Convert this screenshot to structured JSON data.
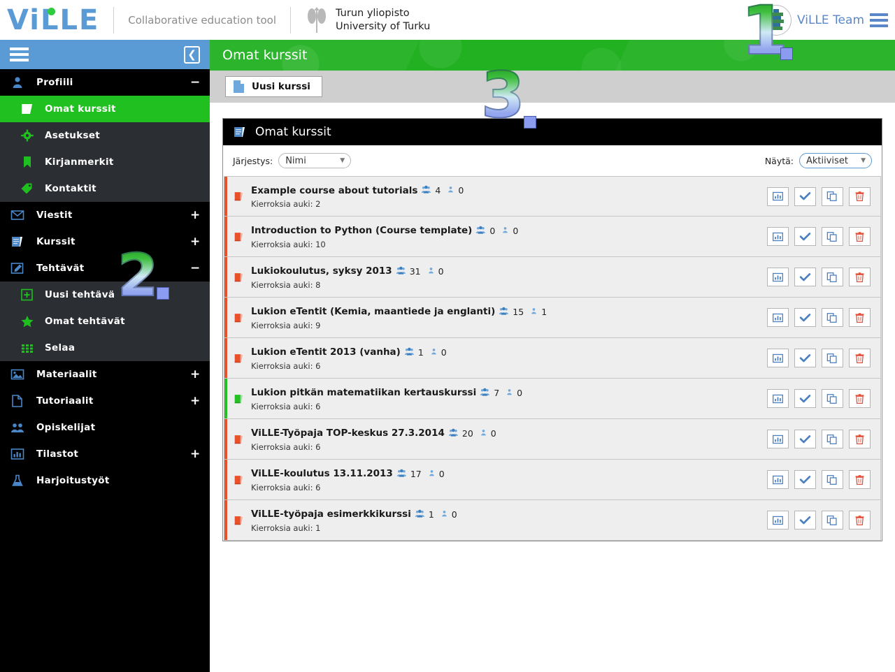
{
  "topbar": {
    "logo_text": "ViLLE",
    "tagline": "Collaborative education tool",
    "university_fi": "Turun yliopisto",
    "university_en": "University of Turku",
    "user_name": "ViLLE Team",
    "menu_icon": "hamburger-icon",
    "avatar_icon": "ville-avatar-icon"
  },
  "sidebar": {
    "menu_icon": "hamburger-icon",
    "collapse_icon": "chevron-left-icon",
    "groups": [
      {
        "label": "Profiili",
        "icon": "user-icon",
        "toggle": "−",
        "expanded": true,
        "items": [
          {
            "label": "Omat kurssit",
            "icon": "book-icon",
            "active": true
          },
          {
            "label": "Asetukset",
            "icon": "gear-icon",
            "active": false
          },
          {
            "label": "Kirjanmerkit",
            "icon": "bookmark-icon",
            "active": false
          },
          {
            "label": "Kontaktit",
            "icon": "tag-icon",
            "active": false
          }
        ]
      },
      {
        "label": "Viestit",
        "icon": "envelope-icon",
        "toggle": "+",
        "expanded": false,
        "items": []
      },
      {
        "label": "Kurssit",
        "icon": "book-icon",
        "toggle": "+",
        "expanded": false,
        "items": []
      },
      {
        "label": "Tehtävät",
        "icon": "pencil-square-icon",
        "toggle": "−",
        "expanded": true,
        "items": [
          {
            "label": "Uusi tehtävä",
            "icon": "plus-square-icon",
            "active": false
          },
          {
            "label": "Omat tehtävät",
            "icon": "star-icon",
            "active": false
          },
          {
            "label": "Selaa",
            "icon": "grid-icon",
            "active": false
          }
        ]
      },
      {
        "label": "Materiaalit",
        "icon": "image-icon",
        "toggle": "+",
        "expanded": false,
        "items": []
      },
      {
        "label": "Tutoriaalit",
        "icon": "document-icon",
        "toggle": "+",
        "expanded": false,
        "items": []
      },
      {
        "label": "Opiskelijat",
        "icon": "people-icon",
        "toggle": "",
        "expanded": false,
        "items": []
      },
      {
        "label": "Tilastot",
        "icon": "chart-icon",
        "toggle": "+",
        "expanded": false,
        "items": []
      },
      {
        "label": "Harjoitustyöt",
        "icon": "flask-icon",
        "toggle": "",
        "expanded": false,
        "items": []
      }
    ]
  },
  "page": {
    "header_title": "Omat kurssit",
    "new_course_button": "Uusi kurssi",
    "new_course_icon": "document-icon",
    "panel_title": "Omat kurssit",
    "panel_icon": "book-icon"
  },
  "filters": {
    "sort_label": "Järjestys:",
    "sort_value": "Nimi",
    "show_label": "Näytä:",
    "show_value": "Aktiiviset",
    "caret_icon": "chevron-down-icon"
  },
  "row_actions": [
    {
      "name": "statistics-button",
      "icon": "bar-chart-icon"
    },
    {
      "name": "approve-button",
      "icon": "check-icon"
    },
    {
      "name": "copy-button",
      "icon": "copy-icon"
    },
    {
      "name": "delete-button",
      "icon": "trash-icon"
    }
  ],
  "labels": {
    "rounds_prefix": "Kierroksia auki:"
  },
  "courses": [
    {
      "title": "Example course about tutorials",
      "students": "4",
      "teachers": "0",
      "rounds": "Kierroksia auki: 2",
      "color": "#e8512a"
    },
    {
      "title": "Introduction to Python (Course template)",
      "students": "0",
      "teachers": "0",
      "rounds": "Kierroksia auki: 10",
      "color": "#e8512a"
    },
    {
      "title": "Lukiokoulutus, syksy 2013",
      "students": "31",
      "teachers": "0",
      "rounds": "Kierroksia auki: 8",
      "color": "#e8512a"
    },
    {
      "title": "Lukion eTentit (Kemia, maantiede ja englanti)",
      "students": "15",
      "teachers": "1",
      "rounds": "Kierroksia auki: 9",
      "color": "#e8512a"
    },
    {
      "title": "Lukion eTentit 2013 (vanha)",
      "students": "1",
      "teachers": "0",
      "rounds": "Kierroksia auki: 6",
      "color": "#e8512a"
    },
    {
      "title": "Lukion pitkän matematiikan kertauskurssi",
      "students": "7",
      "teachers": "0",
      "rounds": "Kierroksia auki: 6",
      "color": "#24c024"
    },
    {
      "title": "ViLLE-Työpaja TOP-keskus 27.3.2014",
      "students": "20",
      "teachers": "0",
      "rounds": "Kierroksia auki: 6",
      "color": "#e8512a"
    },
    {
      "title": "ViLLE-koulutus 13.11.2013",
      "students": "17",
      "teachers": "0",
      "rounds": "Kierroksia auki: 6",
      "color": "#e8512a"
    },
    {
      "title": "ViLLE-työpaja esimerkkikurssi",
      "students": "1",
      "teachers": "0",
      "rounds": "Kierroksia auki: 1",
      "color": "#e8512a"
    }
  ],
  "annotations": [
    {
      "number": "1",
      "target": "user-menu"
    },
    {
      "number": "2",
      "target": "new-task"
    },
    {
      "number": "3",
      "target": "course-panel"
    }
  ],
  "colors": {
    "accent_green": "#21b121",
    "sidebar_blue": "#5b9bd5",
    "active_green": "#21c021",
    "row_orange": "#e8512a",
    "link_blue": "#5b87c9"
  }
}
